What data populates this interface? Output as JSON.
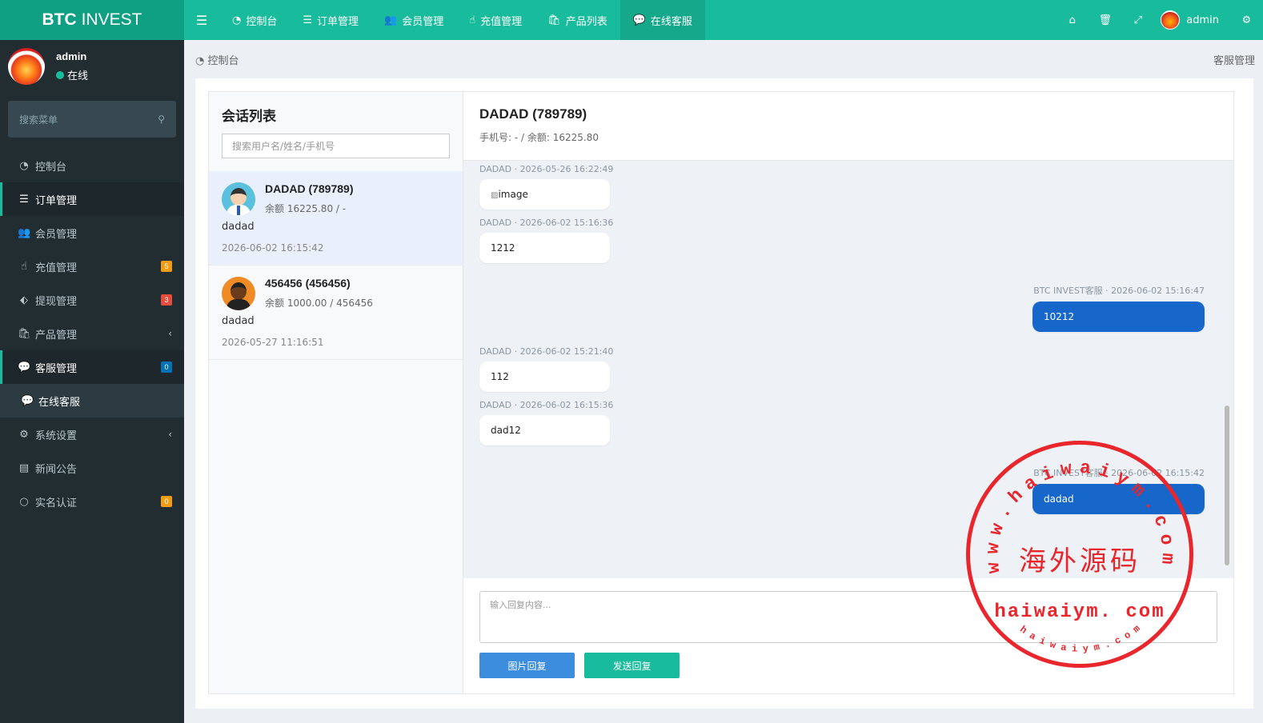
{
  "header": {
    "brand_bold": "BTC",
    "brand_rest": "INVEST",
    "nav": [
      {
        "icon": "dashboard-icon",
        "label": "控制台"
      },
      {
        "icon": "list-icon",
        "label": "订单管理"
      },
      {
        "icon": "users-icon",
        "label": "会员管理"
      },
      {
        "icon": "hand-icon",
        "label": "充值管理"
      },
      {
        "icon": "bag-icon",
        "label": "产品列表"
      },
      {
        "icon": "chat-icon",
        "label": "在线客服",
        "active": true
      }
    ],
    "user_name": "admin"
  },
  "sidebar": {
    "user_name": "admin",
    "status": "在线",
    "search_placeholder": "搜索菜单",
    "items": [
      {
        "icon": "dashboard-icon",
        "label": "控制台"
      },
      {
        "icon": "list-icon",
        "label": "订单管理"
      },
      {
        "icon": "users-icon",
        "label": "会员管理"
      },
      {
        "icon": "hand-icon",
        "label": "充值管理",
        "badge": "5",
        "badge_color": "#f39c12"
      },
      {
        "icon": "tag-icon",
        "label": "提现管理",
        "badge": "3",
        "badge_color": "#e74c3c"
      },
      {
        "icon": "bag-icon",
        "label": "产品管理"
      },
      {
        "icon": "comments-icon",
        "label": "客服管理",
        "badge": "0",
        "badge_color": "#0073b7"
      },
      {
        "icon": "chat-icon",
        "label": "在线客服"
      },
      {
        "icon": "cogs-icon",
        "label": "系统设置"
      },
      {
        "icon": "newspaper-icon",
        "label": "新闻公告"
      },
      {
        "icon": "circle-icon",
        "label": "实名认证",
        "badge": "0",
        "badge_color": "#f39c12"
      }
    ]
  },
  "breadcrumb": {
    "left": "控制台",
    "right": "客服管理"
  },
  "conversations": {
    "title": "会话列表",
    "search_placeholder": "搜索用户名/姓名/手机号",
    "items": [
      {
        "name": "DADAD (789789)",
        "balance": "余额 16225.80 / -",
        "last": "dadad",
        "time": "2026-06-02 16:15:42"
      },
      {
        "name": "456456 (456456)",
        "balance": "余额 1000.00 / 456456",
        "last": "dadad",
        "time": "2026-05-27 11:16:51"
      }
    ]
  },
  "chat": {
    "title": "DADAD (789789)",
    "subtitle": "手机号: - / 余额: 16225.80",
    "messages": [
      {
        "dir": "in",
        "meta": "DADAD · 2026-05-26 16:22:49",
        "text": "image"
      },
      {
        "dir": "in",
        "meta": "DADAD · 2026-06-02 15:16:36",
        "text": "1212"
      },
      {
        "dir": "out",
        "meta": "BTC INVEST客服 · 2026-06-02 15:16:47",
        "text": "10212"
      },
      {
        "dir": "in",
        "meta": "DADAD · 2026-06-02 15:21:40",
        "text": "112"
      },
      {
        "dir": "in",
        "meta": "DADAD · 2026-06-02 16:15:36",
        "text": "dad12"
      },
      {
        "dir": "out",
        "meta": "BTC INVEST客服 · 2026-06-02 16:15:42",
        "text": "dadad"
      }
    ],
    "reply_placeholder": "输入回复内容...",
    "image_button": "图片回复",
    "send_button": "发送回复"
  },
  "watermark": {
    "cn": "海外源码",
    "url": "haiwaiym. com",
    "ring_top": "www.haiwaiym.com",
    "ring_bottom": "haiwaiym.com"
  },
  "colors": {
    "brand": "#18bc9c",
    "sidebar": "#222d32",
    "outgoing_bubble": "#1667c9",
    "image_button": "#3c8dde",
    "send_button": "#18bc9c",
    "stamp": "#e8262c"
  }
}
